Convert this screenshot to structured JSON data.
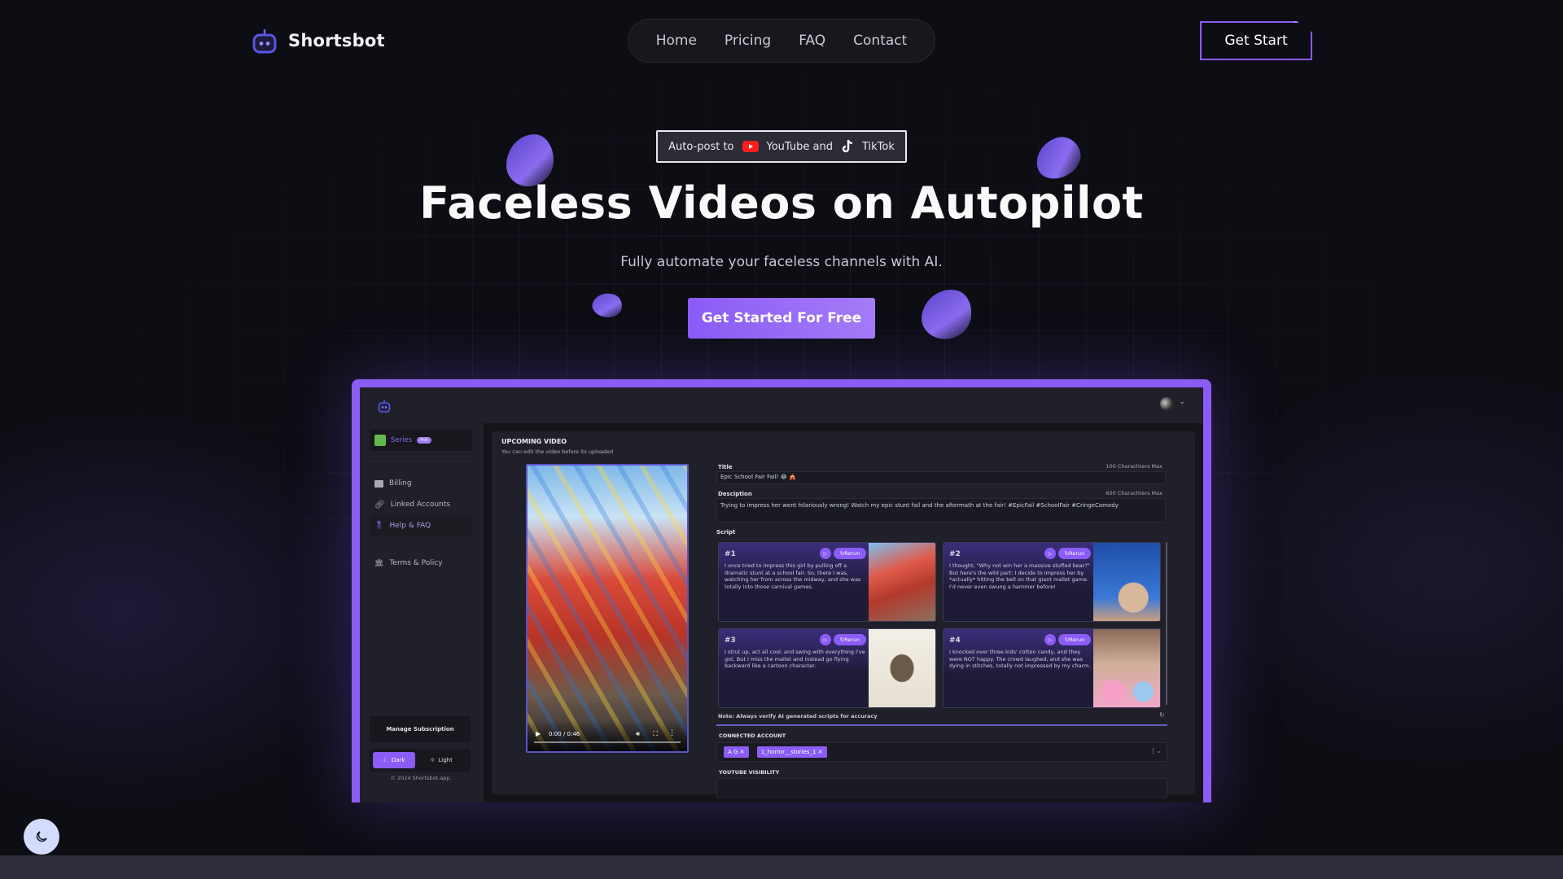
{
  "brand": {
    "name": "Shortsbot",
    "accent": "#8b5cf6"
  },
  "nav": {
    "items": [
      "Home",
      "Pricing",
      "FAQ",
      "Contact"
    ],
    "get_start": "Get Start"
  },
  "hero": {
    "badge": {
      "prefix": "Auto-post to",
      "youtube": "YouTube and",
      "tiktok": "TikTok"
    },
    "title": "Faceless Videos on Autopilot",
    "subtitle": "Fully automate your faceless channels with AI.",
    "cta": "Get Started For Free"
  },
  "app": {
    "sidebar": {
      "series": "Series",
      "series_badge": "Hot",
      "items": [
        "Billing",
        "Linked Accounts",
        "Help & FAQ",
        "Terms & Policy"
      ],
      "manage": "Manage Subscription",
      "dark": "Dark",
      "light": "Light",
      "copyright": "© 2024 Shortsbot.app."
    },
    "upcoming": {
      "heading": "UPCOMING VIDEO",
      "sub": "You can edit the video before its uploaded",
      "player_time": "0:00 / 0:46"
    },
    "form": {
      "title_label": "Title",
      "title_limit": "100 Charachters Max",
      "title_value": "Epic School Fair Fail! 😂 🎪",
      "desc_label": "Desciption",
      "desc_limit": "600 Charachters Max",
      "desc_value": "Trying to impress her went hilariously wrong! Watch my epic stunt fail and the aftermath at the fair! #EpicFail #SchoolFair #CringeComedy",
      "script_label": "Script",
      "rerun": "Rerun",
      "scripts": [
        {
          "num": "#1",
          "text": "I once tried to impress this girl by pulling off a dramatic stunt at a school fair. So, there I was, watching her from across the midway, and she was totally into those carnival games."
        },
        {
          "num": "#2",
          "text": "I thought, \"Why not win her a massive stuffed bear?\" But here's the wild part: I decide to impress her by *actually* hitting the bell on that giant mallet game. I'd never even swung a hammer before!"
        },
        {
          "num": "#3",
          "text": "I strut up, act all cool, and swing with everything I've got. But I miss the mallet and instead go flying backward like a cartoon character."
        },
        {
          "num": "#4",
          "text": "I knocked over three kids' cotton candy, and they were NOT happy. The crowd laughed, and she was dying in stitches, totally not impressed by my charm."
        }
      ],
      "note": "Note: Always verify AI generated scripts for accuracy",
      "connected_label": "CONNECTED ACCOUNT",
      "accounts": [
        "A G",
        "1_horror__stories_1"
      ],
      "visibility_label": "YOUTUBE VISIBILITY"
    }
  }
}
